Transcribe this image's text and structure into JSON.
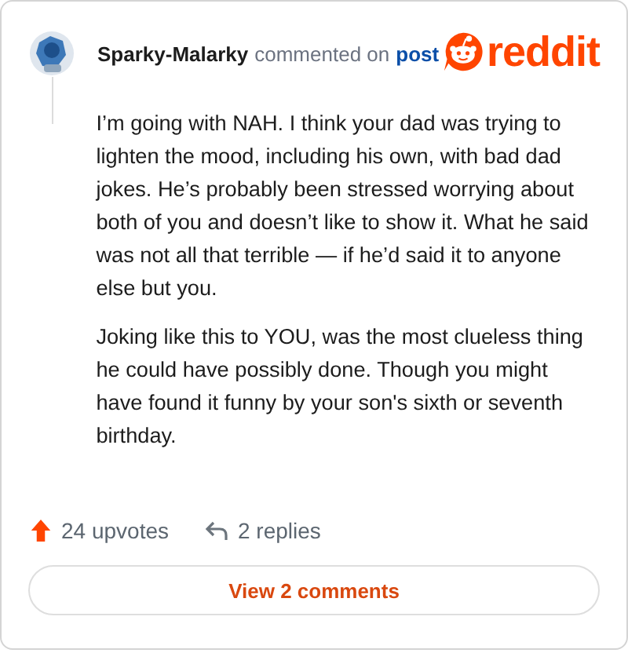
{
  "comment": {
    "author": "Sparky-Malarky",
    "action": "commented on",
    "link": "post"
  },
  "brand": {
    "name": "reddit"
  },
  "paragraphs": [
    "I’m going with NAH. I think your dad was trying to lighten the mood, including his own, with bad dad jokes. He’s probably been stressed worrying about both of you and doesn’t like to show it. What he said was not all that terrible — if he’d said it to anyone else but you.",
    "Joking like this to YOU, was the most clueless thing he could have possibly done. Though you might have found it funny by your son's sixth or seventh birthday."
  ],
  "stats": {
    "upvotes": "24 upvotes",
    "replies": "2 replies"
  },
  "buttons": [
    "View 2 comments"
  ]
}
